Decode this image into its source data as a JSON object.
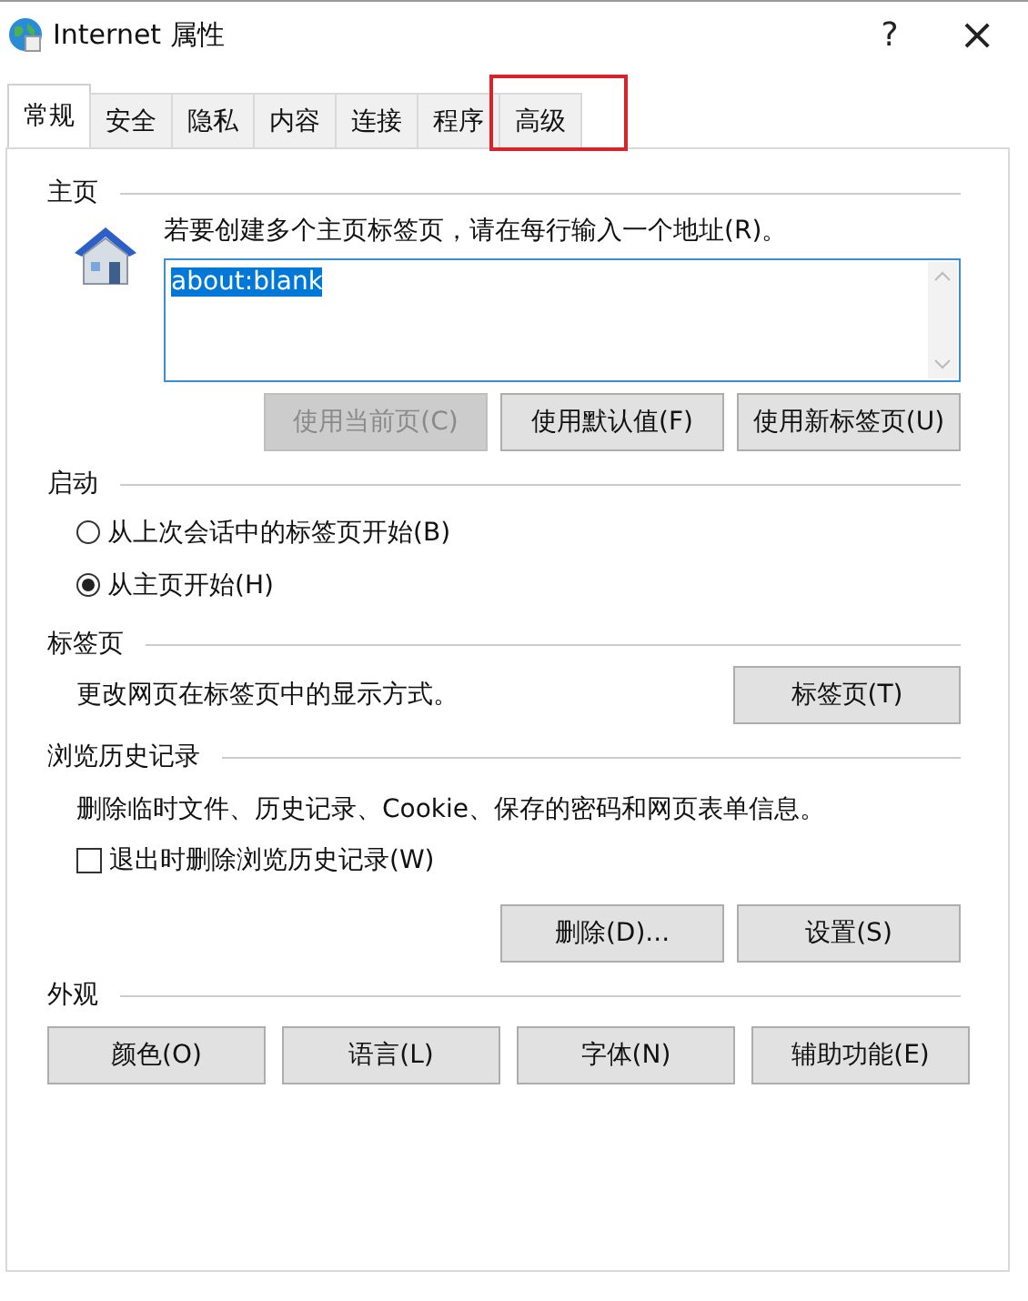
{
  "window": {
    "title": "Internet 属性",
    "help": "?",
    "close": "×"
  },
  "tabs": [
    {
      "label": "常规",
      "selected": true,
      "highlighted": false
    },
    {
      "label": "安全",
      "selected": false,
      "highlighted": false
    },
    {
      "label": "隐私",
      "selected": false,
      "highlighted": false
    },
    {
      "label": "内容",
      "selected": false,
      "highlighted": false
    },
    {
      "label": "连接",
      "selected": false,
      "highlighted": false
    },
    {
      "label": "程序",
      "selected": false,
      "highlighted": false
    },
    {
      "label": "高级",
      "selected": false,
      "highlighted": true
    }
  ],
  "home": {
    "heading": "主页",
    "hint": "若要创建多个主页标签页，请在每行输入一个地址(R)。",
    "value": "about:blank",
    "buttons": [
      {
        "label": "使用当前页(C)",
        "disabled": true
      },
      {
        "label": "使用默认值(F)",
        "disabled": false
      },
      {
        "label": "使用新标签页(U)",
        "disabled": false
      }
    ]
  },
  "startup": {
    "heading": "启动",
    "options": [
      {
        "label": "从上次会话中的标签页开始(B)",
        "selected": false
      },
      {
        "label": "从主页开始(H)",
        "selected": true
      }
    ]
  },
  "tabs_section": {
    "heading": "标签页",
    "text": "更改网页在标签页中的显示方式。",
    "button": "标签页(T)"
  },
  "history": {
    "heading": "浏览历史记录",
    "text": "删除临时文件、历史记录、Cookie、保存的密码和网页表单信息。",
    "checkbox": {
      "label": "退出时删除浏览历史记录(W)",
      "checked": false
    },
    "buttons": [
      "删除(D)...",
      "设置(S)"
    ]
  },
  "appearance": {
    "heading": "外观",
    "buttons": [
      "颜色(O)",
      "语言(L)",
      "字体(N)",
      "辅助功能(E)"
    ]
  }
}
